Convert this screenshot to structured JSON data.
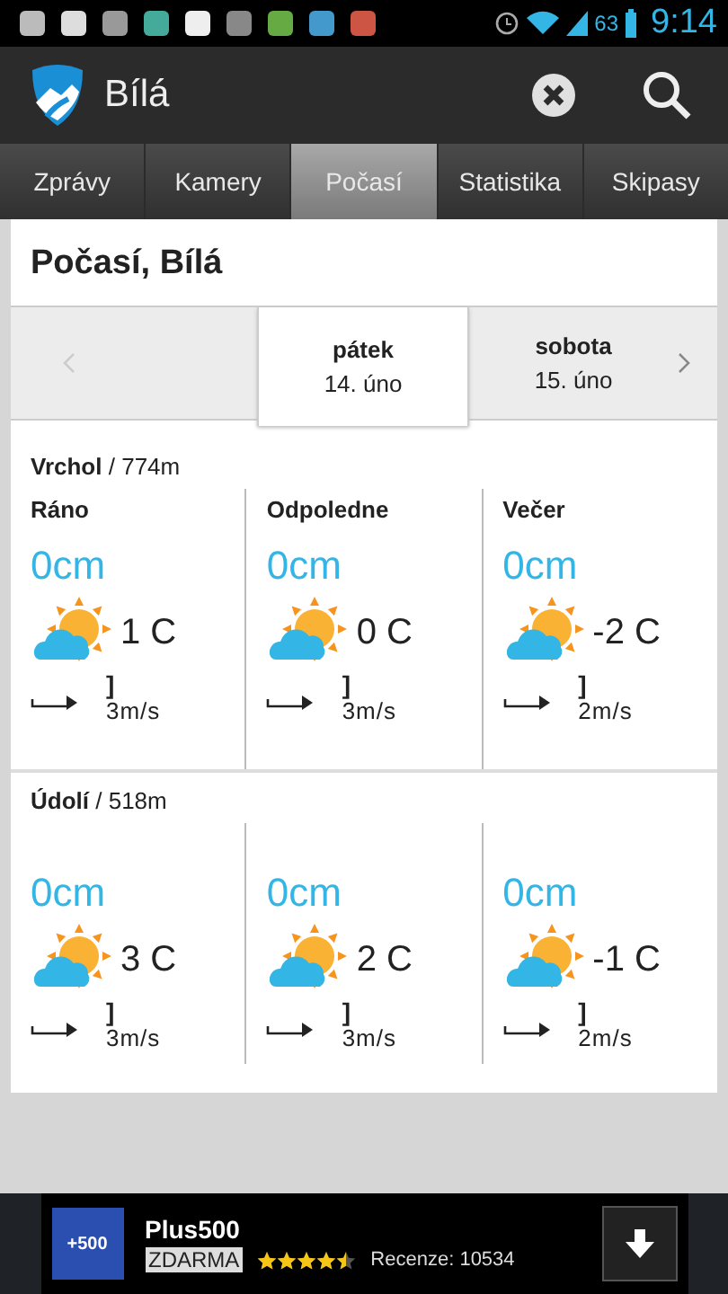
{
  "status_bar": {
    "battery": "63",
    "time": "9:14"
  },
  "app_bar": {
    "title": "Bílá"
  },
  "tabs": [
    {
      "label": "Zprávy",
      "selected": false
    },
    {
      "label": "Kamery",
      "selected": false
    },
    {
      "label": "Počasí",
      "selected": true
    },
    {
      "label": "Statistika",
      "selected": false
    },
    {
      "label": "Skipasy",
      "selected": false
    }
  ],
  "page_title": "Počasí, Bílá",
  "days": [
    {
      "name": "pátek",
      "date": "14. úno",
      "selected": true
    },
    {
      "name": "sobota",
      "date": "15. úno",
      "selected": false
    }
  ],
  "sections": [
    {
      "name": "Vrchol",
      "altitude": " / 774m",
      "periods": [
        {
          "label": "Ráno",
          "snow": "0cm",
          "temp": "1 C",
          "wind_mark": "]",
          "wind": "3m/s"
        },
        {
          "label": "Odpoledne",
          "snow": "0cm",
          "temp": "0 C",
          "wind_mark": "]",
          "wind": "3m/s"
        },
        {
          "label": "Večer",
          "snow": "0cm",
          "temp": "-2 C",
          "wind_mark": "]",
          "wind": "2m/s"
        }
      ]
    },
    {
      "name": "Údolí",
      "altitude": " / 518m",
      "periods": [
        {
          "snow": "0cm",
          "temp": "3 C",
          "wind_mark": "]",
          "wind": "3m/s"
        },
        {
          "snow": "0cm",
          "temp": "2 C",
          "wind_mark": "]",
          "wind": "3m/s"
        },
        {
          "snow": "0cm",
          "temp": "-1 C",
          "wind_mark": "]",
          "wind": "2m/s"
        }
      ]
    }
  ],
  "ad": {
    "icon_text": "+500",
    "title": "Plus500",
    "price": "ZDARMA",
    "stars": 4.5,
    "reviews": "Recenze: 10534"
  }
}
